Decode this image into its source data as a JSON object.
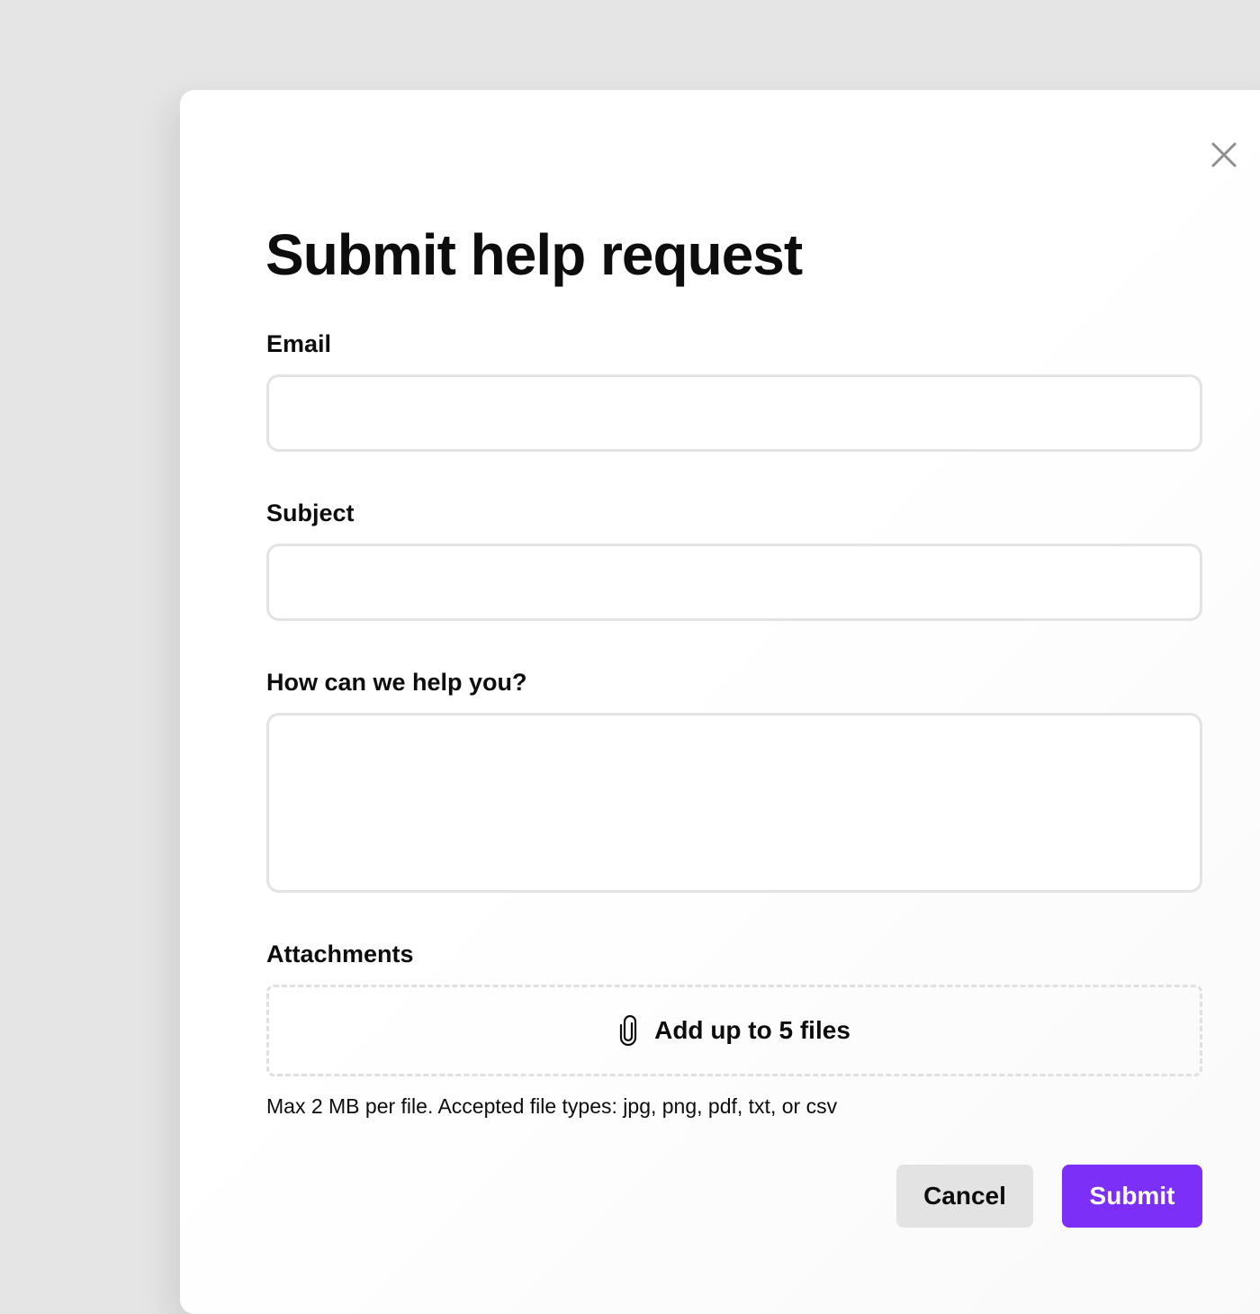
{
  "modal": {
    "title": "Submit help request",
    "close_icon": "close-icon"
  },
  "form": {
    "email": {
      "label": "Email",
      "value": "",
      "placeholder": ""
    },
    "subject": {
      "label": "Subject",
      "value": "",
      "placeholder": ""
    },
    "message": {
      "label": "How can we help you?",
      "value": "",
      "placeholder": ""
    },
    "attachments": {
      "label": "Attachments",
      "dropzone_label": "Add up to 5 files",
      "dropzone_icon": "paperclip-icon",
      "hint": "Max 2 MB per file. Accepted file types: jpg, png, pdf, txt, or csv"
    }
  },
  "actions": {
    "cancel_label": "Cancel",
    "submit_label": "Submit"
  },
  "colors": {
    "background": "#e5e5e5",
    "accent": "#7b2ff7",
    "field_border": "#e3e3e3",
    "cancel_bg": "#e3e3e3"
  }
}
